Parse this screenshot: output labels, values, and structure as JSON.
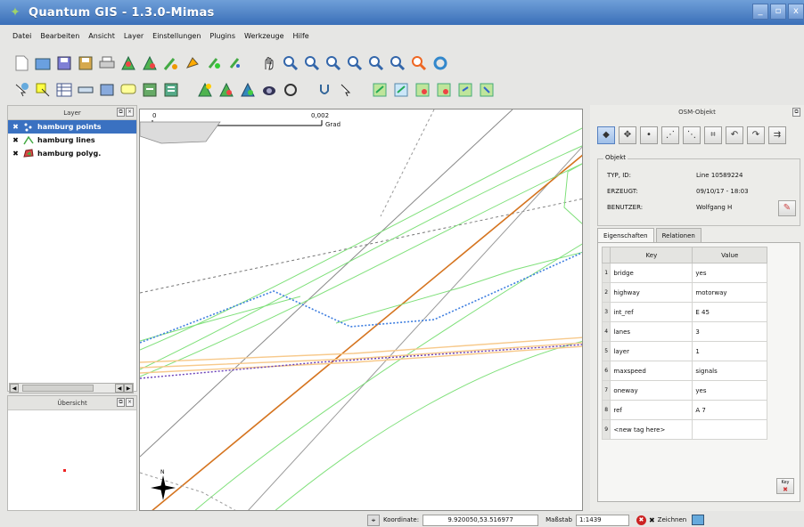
{
  "window": {
    "title": "Quantum GIS - 1.3.0-Mimas",
    "controls": [
      "_",
      "▫",
      "x"
    ]
  },
  "menu": [
    "Datei",
    "Bearbeiten",
    "Ansicht",
    "Layer",
    "Einstellungen",
    "Plugins",
    "Werkzeuge",
    "Hilfe"
  ],
  "toolbar1_icons": [
    "new-project-icon",
    "open-project-icon",
    "save-project-icon",
    "save-as-icon",
    "print-icon",
    "digitize-icon",
    "capture-point-icon",
    "capture-line-icon",
    "capture-polygon-icon",
    "move-feature-icon",
    "add-vertex-icon",
    "pan-icon",
    "zoom-in-icon",
    "zoom-out-icon",
    "zoom-full-icon",
    "zoom-selection-icon",
    "zoom-layer-icon",
    "zoom-last-icon",
    "refresh-icon",
    "help-icon"
  ],
  "toolbar2_icons": [
    "identify-icon",
    "select-icon",
    "attribute-table-icon",
    "measure-icon",
    "measure-area-icon",
    "map-tips-icon",
    "new-bookmark-icon",
    "show-bookmarks-icon",
    "add-vector-layer-icon",
    "add-raster-layer-icon",
    "add-postgis-icon",
    "add-wms-icon",
    "remove-layer-icon",
    "osm-identify-icon",
    "osm-move-icon",
    "osm-load-icon",
    "osm-save-icon",
    "osm-download-icon",
    "osm-upload-icon",
    "osm-import-icon",
    "osm-export-icon"
  ],
  "layers_panel": {
    "title": "Layer",
    "items": [
      {
        "label": "hamburg points",
        "selected": true
      },
      {
        "label": "hamburg lines",
        "selected": false
      },
      {
        "label": "hamburg polyg.",
        "selected": false
      }
    ]
  },
  "overview_panel": {
    "title": "Übersicht"
  },
  "map": {
    "scale_left": "0",
    "scale_right": "0,002",
    "scale_unit": "Grad"
  },
  "osm_panel": {
    "title": "OSM-Objekt",
    "object_legend": "Objekt",
    "type_id_key": "TYP, ID:",
    "type_id_val": "Line 10589224",
    "created_key": "ERZEUGT:",
    "created_val": "09/10/17 - 18:03",
    "user_key": "BENUTZER:",
    "user_val": "Wolfgang H",
    "tab_props": "Eigenschaften",
    "tab_relations": "Relationen",
    "col_key": "Key",
    "col_value": "Value",
    "rows": [
      {
        "n": "1",
        "key": "bridge",
        "value": "yes"
      },
      {
        "n": "2",
        "key": "highway",
        "value": "motorway"
      },
      {
        "n": "3",
        "key": "int_ref",
        "value": "E 45"
      },
      {
        "n": "4",
        "key": "lanes",
        "value": "3"
      },
      {
        "n": "5",
        "key": "layer",
        "value": "1"
      },
      {
        "n": "6",
        "key": "maxspeed",
        "value": "signals"
      },
      {
        "n": "7",
        "key": "oneway",
        "value": "yes"
      },
      {
        "n": "8",
        "key": "ref",
        "value": "A 7"
      },
      {
        "n": "9",
        "key": "<new tag here>",
        "value": ""
      }
    ],
    "key_btn_label": "Key"
  },
  "statusbar": {
    "coord_label": "Koordinate:",
    "coord_value": "9.920050,53.516977",
    "scale_label": "Maßstab",
    "scale_value": "1:1439",
    "render_label": "Zeichnen"
  },
  "colors": {
    "title_bg": "#4a7fc6",
    "selection": "#3a71c1",
    "green_lines": "#7fe07a",
    "orange_line": "#d5741f",
    "blue_dotted": "#3f7fe0",
    "peach_lines": "#f7c98b",
    "purple_dotted": "#6a3fb8"
  }
}
